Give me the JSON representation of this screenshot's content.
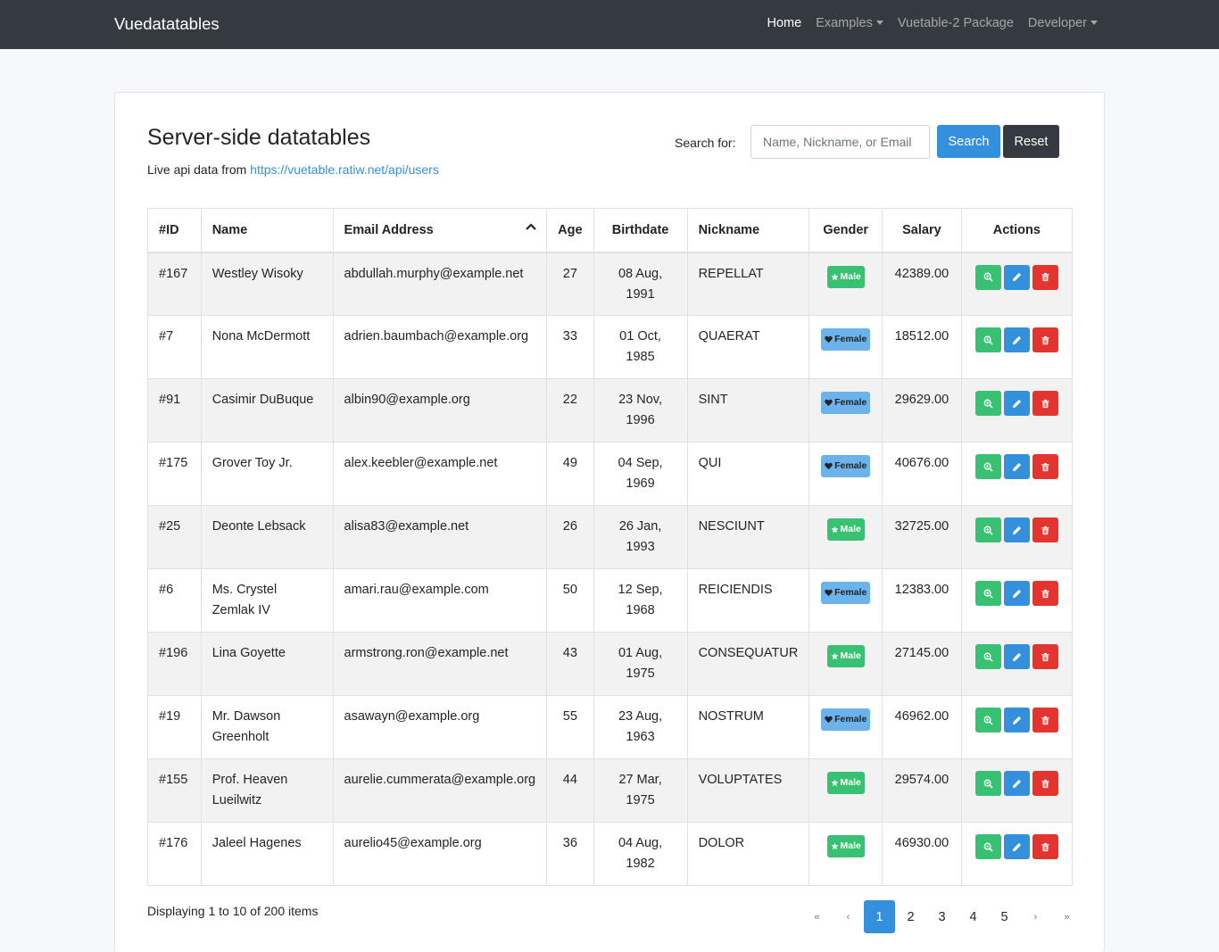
{
  "navbar": {
    "brand": "Vuedatatables",
    "items": [
      {
        "label": "Home",
        "active": true,
        "dropdown": false
      },
      {
        "label": "Examples",
        "active": false,
        "dropdown": true
      },
      {
        "label": "Vuetable-2 Package",
        "active": false,
        "dropdown": false
      },
      {
        "label": "Developer",
        "active": false,
        "dropdown": true
      }
    ]
  },
  "page": {
    "title": "Server-side datatables",
    "subtitle_prefix": "Live api data from ",
    "subtitle_link": "https://vuetable.ratiw.net/api/users"
  },
  "search": {
    "label": "Search for:",
    "placeholder": "Name, Nickname, or Email",
    "value": "",
    "search_button": "Search",
    "reset_button": "Reset"
  },
  "table": {
    "columns": [
      "#ID",
      "Name",
      "Email Address",
      "Age",
      "Birthdate",
      "Nickname",
      "Gender",
      "Salary",
      "Actions"
    ],
    "sorted_column": "Email Address",
    "sort_direction": "asc",
    "rows": [
      {
        "id": "#167",
        "name": "Westley Wisoky",
        "email": "abdullah.murphy@example.net",
        "age": "27",
        "birthdate": "08 Aug, 1991",
        "nickname": "REPELLAT",
        "gender": "Male",
        "salary": "42389.00"
      },
      {
        "id": "#7",
        "name": "Nona McDermott",
        "email": "adrien.baumbach@example.org",
        "age": "33",
        "birthdate": "01 Oct, 1985",
        "nickname": "QUAERAT",
        "gender": "Female",
        "salary": "18512.00"
      },
      {
        "id": "#91",
        "name": "Casimir DuBuque",
        "email": "albin90@example.org",
        "age": "22",
        "birthdate": "23 Nov, 1996",
        "nickname": "SINT",
        "gender": "Female",
        "salary": "29629.00"
      },
      {
        "id": "#175",
        "name": "Grover Toy Jr.",
        "email": "alex.keebler@example.net",
        "age": "49",
        "birthdate": "04 Sep, 1969",
        "nickname": "QUI",
        "gender": "Female",
        "salary": "40676.00"
      },
      {
        "id": "#25",
        "name": "Deonte Lebsack",
        "email": "alisa83@example.net",
        "age": "26",
        "birthdate": "26 Jan, 1993",
        "nickname": "NESCIUNT",
        "gender": "Male",
        "salary": "32725.00"
      },
      {
        "id": "#6",
        "name": "Ms. Crystel Zemlak IV",
        "email": "amari.rau@example.com",
        "age": "50",
        "birthdate": "12 Sep, 1968",
        "nickname": "REICIENDIS",
        "gender": "Female",
        "salary": "12383.00"
      },
      {
        "id": "#196",
        "name": "Lina Goyette",
        "email": "armstrong.ron@example.net",
        "age": "43",
        "birthdate": "01 Aug, 1975",
        "nickname": "CONSEQUATUR",
        "gender": "Male",
        "salary": "27145.00"
      },
      {
        "id": "#19",
        "name": "Mr. Dawson Greenholt",
        "email": "asawayn@example.org",
        "age": "55",
        "birthdate": "23 Aug, 1963",
        "nickname": "NOSTRUM",
        "gender": "Female",
        "salary": "46962.00"
      },
      {
        "id": "#155",
        "name": "Prof. Heaven Lueilwitz",
        "email": "aurelie.cummerata@example.org",
        "age": "44",
        "birthdate": "27 Mar, 1975",
        "nickname": "VOLUPTATES",
        "gender": "Male",
        "salary": "29574.00"
      },
      {
        "id": "#176",
        "name": "Jaleel Hagenes",
        "email": "aurelio45@example.org",
        "age": "36",
        "birthdate": "04 Aug, 1982",
        "nickname": "DOLOR",
        "gender": "Male",
        "salary": "46930.00"
      }
    ]
  },
  "footer": {
    "info": "Displaying 1 to 10 of 200 items",
    "pagination": {
      "first": "«",
      "prev": "‹",
      "pages": [
        "1",
        "2",
        "3",
        "4",
        "5"
      ],
      "current": "1",
      "next": "›",
      "last": "»"
    }
  },
  "colors": {
    "navbar": "#343a40",
    "primary": "#3490dc",
    "success": "#38c172",
    "danger": "#e3342f",
    "info": "#6cb2eb"
  },
  "icons": {
    "male_badge": "star-icon",
    "female_badge": "heart-icon",
    "view": "zoom-in-icon",
    "edit": "pencil-icon",
    "delete": "trash-icon",
    "sort": "chevron-up-icon"
  }
}
